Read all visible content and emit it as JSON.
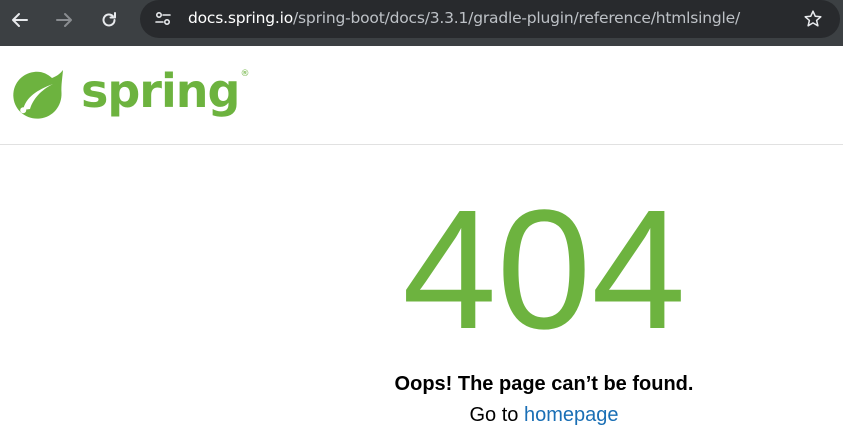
{
  "browser": {
    "url_host": "docs.spring.io",
    "url_path": "/spring-boot/docs/3.3.1/gradle-plugin/reference/htmlsingle/",
    "icons": [
      "back-arrow-icon",
      "forward-arrow-icon",
      "reload-icon",
      "site-info-icon",
      "bookmark-star-icon"
    ]
  },
  "header": {
    "logo_text": "spring",
    "logo_mark": "®",
    "brand_color": "#6db33f"
  },
  "error": {
    "code": "404",
    "message": "Oops! The page can’t be found.",
    "goto_prefix": "Go to ",
    "homepage_link": "homepage",
    "link_color": "#1a6fb5"
  }
}
